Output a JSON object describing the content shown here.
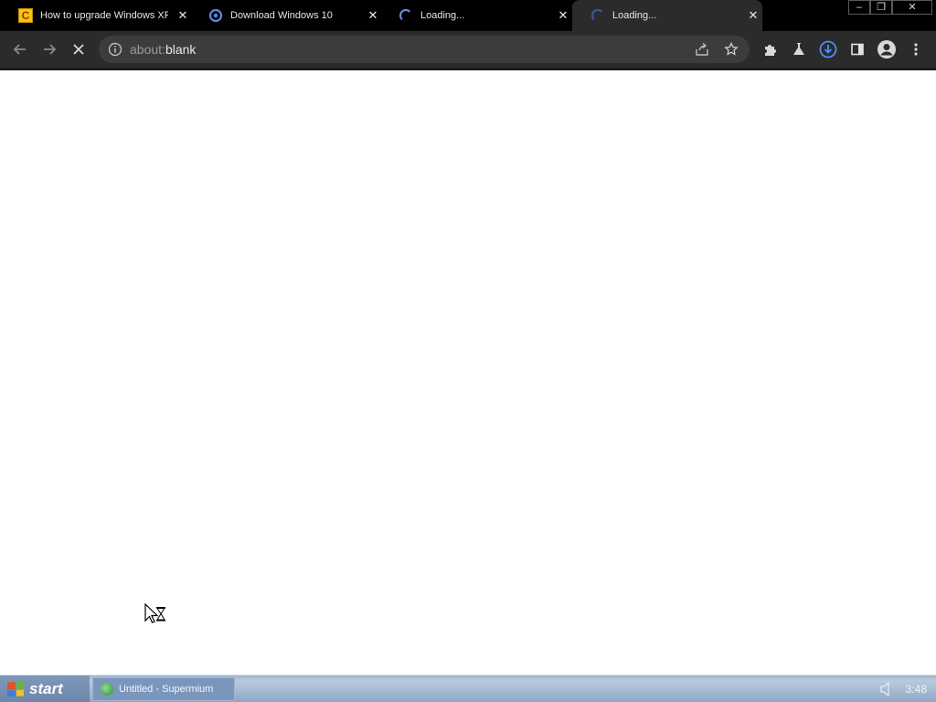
{
  "tabs": [
    {
      "title": "How to upgrade Windows XP",
      "favicon": "site-c-icon"
    },
    {
      "title": "Download Windows 10",
      "favicon": "loading-ring-icon"
    },
    {
      "title": "Loading...",
      "favicon": "spinner-icon"
    },
    {
      "title": "Loading...",
      "favicon": "spinner-icon",
      "active": true
    }
  ],
  "window_controls": {
    "minimize": "–",
    "restore": "❐",
    "close": "✕"
  },
  "toolbar": {
    "address_scheme": "about:",
    "address_host": "blank"
  },
  "taskbar": {
    "start_label": "start",
    "task_label": "Untitled - Supermium",
    "clock": "3:48"
  },
  "colors": {
    "tab_strip_bg": "#000000",
    "toolbar_bg": "#2b2b2b",
    "download_accent": "#4c8dff",
    "taskbar_bg": "#a4b9d2"
  }
}
